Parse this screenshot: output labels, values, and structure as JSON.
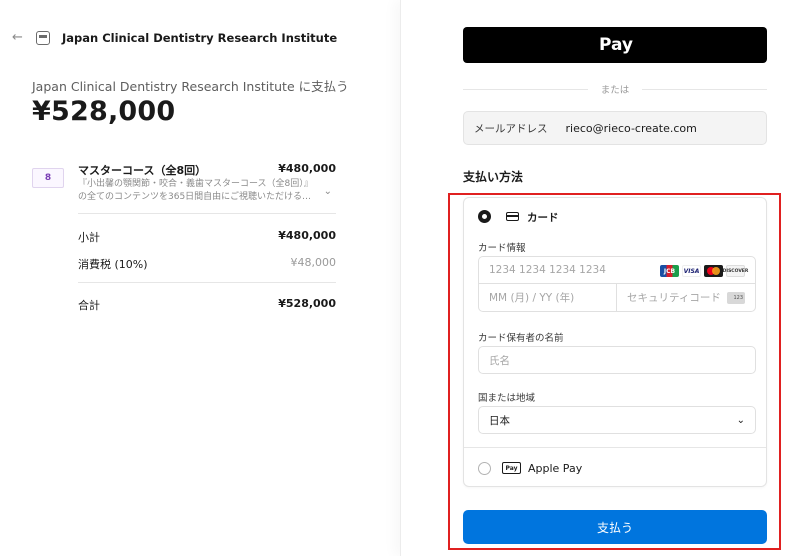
{
  "merchant": {
    "name": "Japan Clinical Dentistry Research Institute",
    "back_icon": "arrow-left-icon",
    "store_icon": "store-icon"
  },
  "summary": {
    "pay_to": "Japan Clinical Dentistry Research Institute に支払う",
    "total": "¥528,000",
    "item": {
      "thumb_text": "8",
      "name": "マスターコース（全8回）",
      "price": "¥480,000",
      "desc_line1": "『小出馨の顎関節・咬合・義歯マスターコース（全8回）』",
      "desc_line2": "の全てのコンテンツを365日間自由にご視聴いただけるセ..."
    },
    "subtotal_label": "小計",
    "subtotal_value": "¥480,000",
    "tax_label": "消費税 (10%)",
    "tax_value": "¥48,000",
    "total_label": "合計",
    "total_value": "¥528,000"
  },
  "payment": {
    "apple_pay_button": "Pay",
    "or_text": "または",
    "email_label": "メールアドレス",
    "email_value": "rieco@rieco-create.com",
    "method_title": "支払い方法",
    "card_option_label": "カード",
    "card_info_label": "カード情報",
    "card_number_placeholder": "1234 1234 1234 1234",
    "card_exp_placeholder": "MM (月) / YY (年)",
    "card_cvc_placeholder": "セキュリティコード",
    "brands": [
      "JCB",
      "VISA",
      "",
      "DISCOVER"
    ],
    "cvc_badge": "123",
    "cardholder_label": "カード保有者の名前",
    "cardholder_placeholder": "氏名",
    "country_label": "国または地域",
    "country_value": "日本",
    "applepay_badge": "Pay",
    "applepay_option_label": "Apple Pay",
    "submit_label": "支払う",
    "submit_color": "#0075de",
    "highlight_color": "#e02020"
  }
}
